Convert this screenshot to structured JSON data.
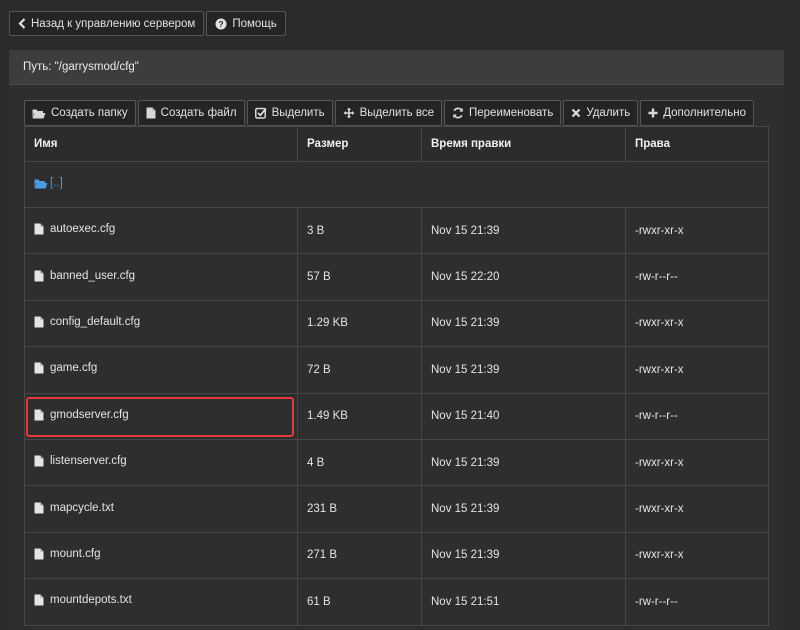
{
  "top_nav": {
    "back_label": "Назад к управлению сервером",
    "help_label": "Помощь"
  },
  "panel": {
    "path_label": "Путь: \"/garrysmod/cfg\""
  },
  "toolbar": {
    "create_folder": "Создать папку",
    "create_file": "Создать файл",
    "select": "Выделить",
    "select_all": "Выделить все",
    "rename": "Переименовать",
    "delete": "Удалить",
    "more": "Дополнительно"
  },
  "table": {
    "headers": {
      "name": "Имя",
      "size": "Размер",
      "mtime": "Время правки",
      "perms": "Права"
    },
    "up_label": "[..]",
    "rows": [
      {
        "name": "autoexec.cfg",
        "size": "3 B",
        "mtime": "Nov 15 21:39",
        "perms": "-rwxr-xr-x"
      },
      {
        "name": "banned_user.cfg",
        "size": "57 B",
        "mtime": "Nov 15 22:20",
        "perms": "-rw-r--r--"
      },
      {
        "name": "config_default.cfg",
        "size": "1.29 KB",
        "mtime": "Nov 15 21:39",
        "perms": "-rwxr-xr-x"
      },
      {
        "name": "game.cfg",
        "size": "72 B",
        "mtime": "Nov 15 21:39",
        "perms": "-rwxr-xr-x"
      },
      {
        "name": "gmodserver.cfg",
        "size": "1.49 KB",
        "mtime": "Nov 15 21:40",
        "perms": "-rw-r--r--"
      },
      {
        "name": "listenserver.cfg",
        "size": "4 B",
        "mtime": "Nov 15 21:39",
        "perms": "-rwxr-xr-x"
      },
      {
        "name": "mapcycle.txt",
        "size": "231 B",
        "mtime": "Nov 15 21:39",
        "perms": "-rwxr-xr-x"
      },
      {
        "name": "mount.cfg",
        "size": "271 B",
        "mtime": "Nov 15 21:39",
        "perms": "-rwxr-xr-x"
      },
      {
        "name": "mountdepots.txt",
        "size": "61 B",
        "mtime": "Nov 15 21:51",
        "perms": "-rw-r--r--"
      }
    ]
  },
  "colors": {
    "link": "#4a9be0",
    "highlight": "#e03a3a"
  }
}
